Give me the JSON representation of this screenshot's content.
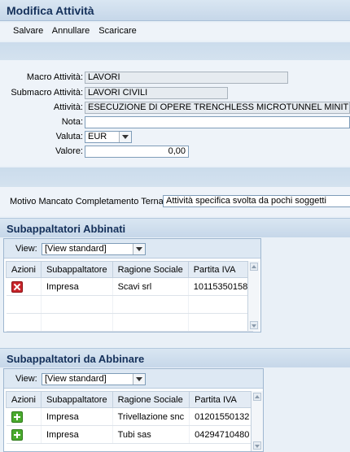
{
  "title": "Modifica Attività",
  "toolbar": {
    "save": "Salvare",
    "cancel": "Annullare",
    "download": "Scaricare"
  },
  "form": {
    "macro": {
      "label": "Macro Attività:",
      "value": "LAVORI"
    },
    "submacro": {
      "label": "Submacro Attività:",
      "value": "LAVORI CIVILI"
    },
    "attivita": {
      "label": "Attività:",
      "value": "ESECUZIONE DI OPERE TRENCHLESS MICROTUNNEL MINITUNNEL"
    },
    "nota": {
      "label": "Nota:",
      "value": ""
    },
    "valuta": {
      "label": "Valuta:",
      "value": "EUR"
    },
    "valore": {
      "label": "Valore:",
      "value": "0,00"
    }
  },
  "motivo": {
    "label": "Motivo Mancato Completamento Terna:",
    "value": "Attività specifica svolta da pochi soggetti"
  },
  "abbinati": {
    "title": "Subappaltatori Abbinati",
    "view_label": "View:",
    "view_value": "[View standard]",
    "columns": [
      "Azioni",
      "Subappaltatore",
      "Ragione Sociale",
      "Partita IVA"
    ],
    "rows": [
      {
        "subappaltatore": "Impresa",
        "ragione": "Scavi srl",
        "piva": "10115350158",
        "icon": "delete-icon"
      }
    ]
  },
  "da_abbinare": {
    "title": "Subappaltatori da Abbinare",
    "view_label": "View:",
    "view_value": "[View standard]",
    "columns": [
      "Azioni",
      "Subappaltatore",
      "Ragione Sociale",
      "Partita IVA"
    ],
    "rows": [
      {
        "subappaltatore": "Impresa",
        "ragione": "Trivellazione snc",
        "piva": "01201550132",
        "icon": "add-icon"
      },
      {
        "subappaltatore": "Impresa",
        "ragione": "Tubi sas",
        "piva": "04294710480",
        "icon": "add-icon"
      }
    ]
  }
}
